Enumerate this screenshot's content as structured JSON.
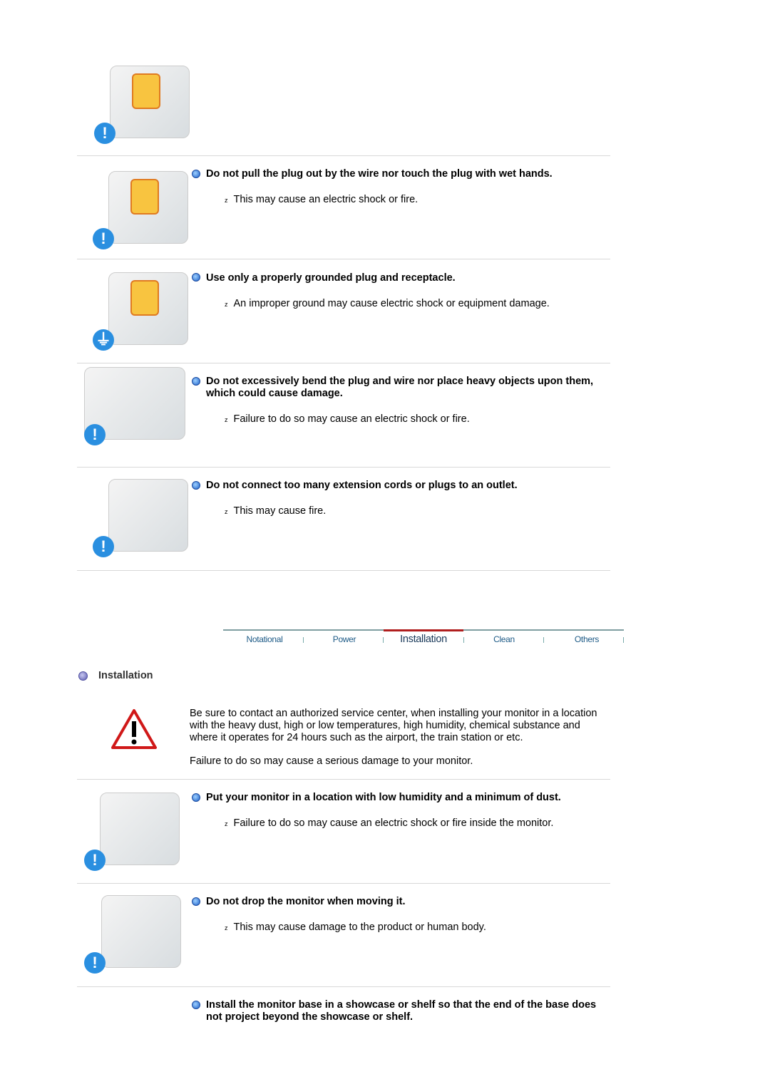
{
  "items": [
    {
      "title": "Do not pull the plug out by the wire nor touch the plug with wet hands.",
      "note": "This may cause an electric shock or fire."
    },
    {
      "title": "Use only a properly grounded plug and receptacle.",
      "note": "An improper ground may cause electric shock or equipment damage."
    },
    {
      "title": "Do not excessively bend the plug and wire nor place heavy objects upon them, which could cause damage.",
      "note": "Failure to do so may cause an electric shock or fire."
    },
    {
      "title": "Do not connect too many extension cords or plugs to an outlet.",
      "note": "This may cause fire."
    },
    {
      "title": "Put your monitor in a location with low humidity and a minimum of dust.",
      "note": "Failure to do so may cause an electric shock or fire inside the monitor."
    },
    {
      "title": "Do not drop the monitor when moving it.",
      "note": "This may cause damage to the product or human body."
    },
    {
      "title": "Install the monitor base in a showcase or shelf so that the end of the base does not project beyond the showcase or shelf."
    }
  ],
  "tabs": [
    "Notational",
    "Power",
    "Installation",
    "Clean",
    "Others"
  ],
  "active_tab": "Installation",
  "accent": "#b01e1e",
  "section": {
    "heading": "Installation",
    "para1": "Be sure to contact an authorized service center, when installing your monitor in a location with the heavy dust, high or low temperatures, high humidity, chemical substance and where it operates for 24 hours such as the airport, the train station or etc.",
    "para2": "Failure to do so may cause a serious damage to your monitor."
  }
}
